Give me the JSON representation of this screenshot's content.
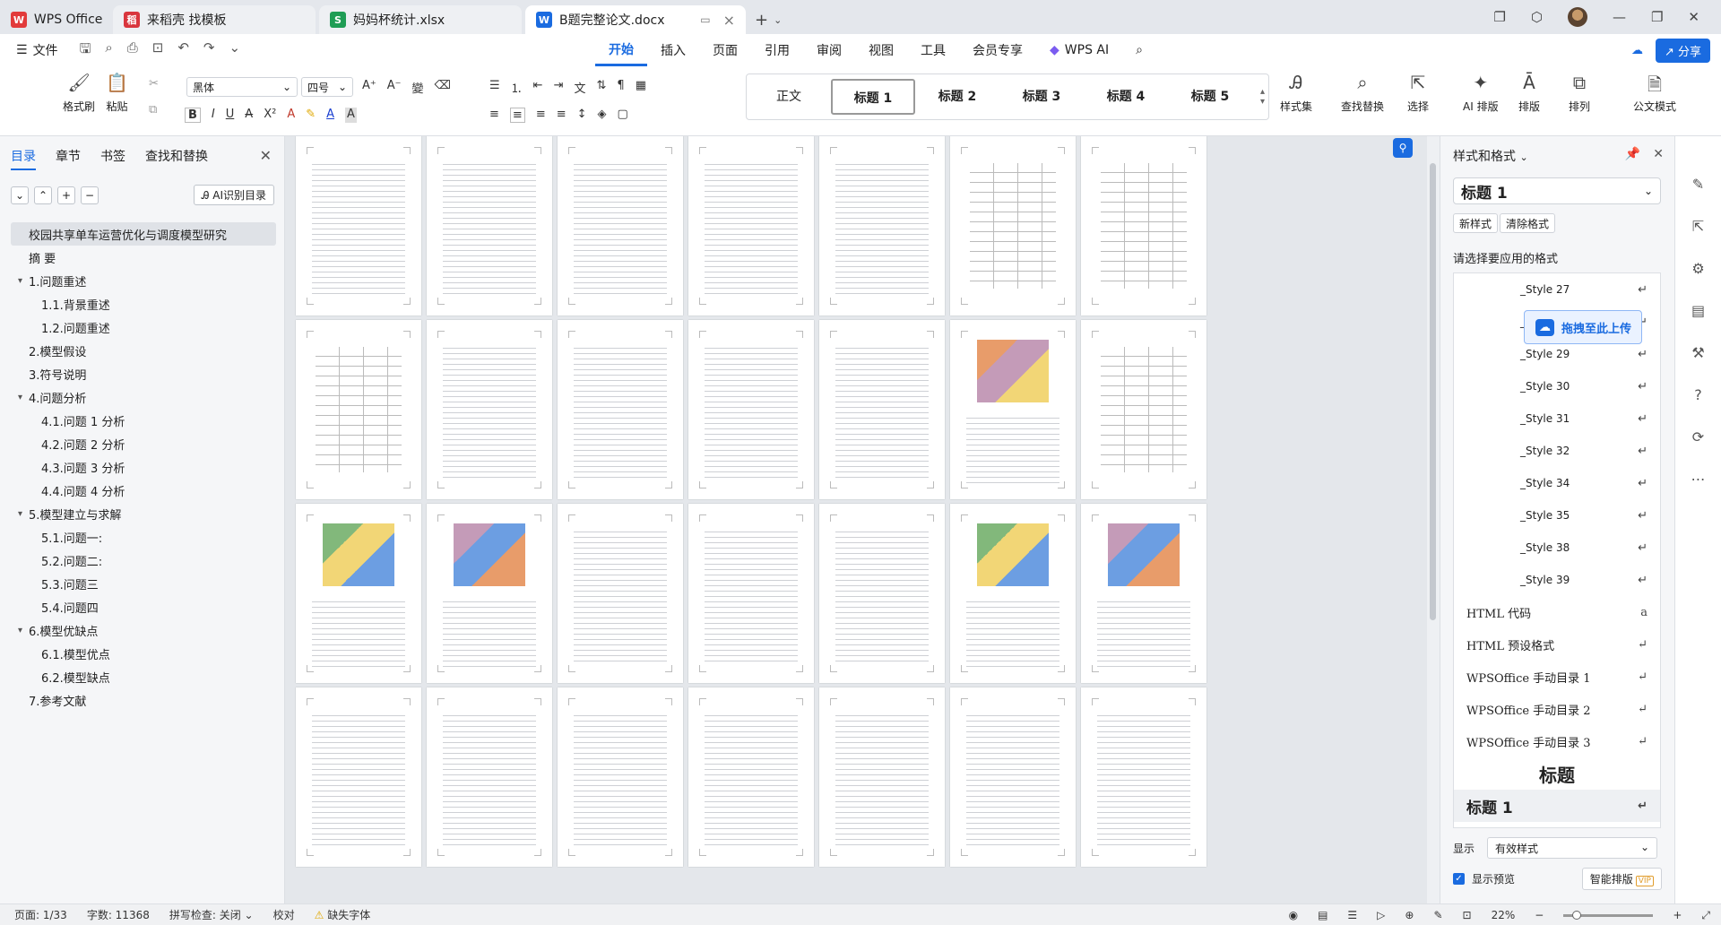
{
  "tabs": [
    {
      "label": "WPS Office",
      "badge": "W",
      "color": "#e23b3b"
    },
    {
      "label": "来稻壳 找模板",
      "badge": "稻",
      "color": "#d9363e"
    },
    {
      "label": "妈妈杯统计.xlsx",
      "badge": "S",
      "color": "#1f9d55"
    },
    {
      "label": "B题完整论文.docx",
      "badge": "W",
      "color": "#1a6be0"
    }
  ],
  "menu": {
    "file": "文件",
    "ribbon_tabs": [
      "开始",
      "插入",
      "页面",
      "引用",
      "审阅",
      "视图",
      "工具",
      "会员专享",
      "WPS AI"
    ],
    "share": "分享"
  },
  "ribbon": {
    "format_painter": "格式刷",
    "paste": "粘贴",
    "font_name": "黑体",
    "font_size": "四号",
    "styles": [
      "正文",
      "标题 1",
      "标题 2",
      "标题 3",
      "标题 4",
      "标题 5"
    ],
    "style_set": "样式集",
    "find_replace": "查找替换",
    "select": "选择",
    "ai_layout": "AI 排版",
    "layout": "排版",
    "arrange": "排列",
    "official": "公文模式"
  },
  "left_panel": {
    "tabs": [
      "目录",
      "章节",
      "书签",
      "查找和替换"
    ],
    "ai_toc": "AI识别目录",
    "toc": [
      {
        "text": "校园共享单车运营优化与调度模型研究",
        "level": 0,
        "selected": true
      },
      {
        "text": "摘  要",
        "level": 1
      },
      {
        "text": "1.问题重述",
        "level": 1,
        "expand": true
      },
      {
        "text": "1.1.背景重述",
        "level": 2
      },
      {
        "text": "1.2.问题重述",
        "level": 2
      },
      {
        "text": "2.模型假设",
        "level": 1
      },
      {
        "text": "3.符号说明",
        "level": 1
      },
      {
        "text": "4.问题分析",
        "level": 1,
        "expand": true
      },
      {
        "text": "4.1.问题 1 分析",
        "level": 2
      },
      {
        "text": "4.2.问题 2 分析",
        "level": 2
      },
      {
        "text": "4.3.问题 3 分析",
        "level": 2
      },
      {
        "text": "4.4.问题 4 分析",
        "level": 2
      },
      {
        "text": "5.模型建立与求解",
        "level": 1,
        "expand": true
      },
      {
        "text": "5.1.问题一:",
        "level": 2
      },
      {
        "text": "5.2.问题二:",
        "level": 2
      },
      {
        "text": "5.3.问题三",
        "level": 2
      },
      {
        "text": "5.4.问题四",
        "level": 2
      },
      {
        "text": "6.模型优缺点",
        "level": 1,
        "expand": true
      },
      {
        "text": "6.1.模型优点",
        "level": 2
      },
      {
        "text": "6.2.模型缺点",
        "level": 2
      },
      {
        "text": "7.参考文献",
        "level": 1
      }
    ]
  },
  "upload_chip": "拖拽至此上传",
  "right_panel": {
    "title": "样式和格式",
    "current_style": "标题 1",
    "new_style": "新样式",
    "clear_format": "清除格式",
    "apply_label": "请选择要应用的格式",
    "styles": [
      "_Style 27",
      "_Style 28",
      "_Style 29",
      "_Style 30",
      "_Style 31",
      "_Style 32",
      "_Style 34",
      "_Style 35",
      "_Style 38",
      "_Style 39",
      "HTML 代码",
      "HTML 预设格式",
      "WPSOffice 手动目录 1",
      "WPSOffice 手动目录 2",
      "WPSOffice 手动目录 3",
      "标题",
      "标题 1"
    ],
    "show_label": "显示",
    "show_value": "有效样式",
    "preview": "显示预览",
    "smart_layout": "智能排版",
    "vip": "VIP"
  },
  "status": {
    "page": "页面: 1/33",
    "words": "字数: 11368",
    "spell": "拼写检查: 关闭",
    "proof": "校对",
    "missing_font": "缺失字体",
    "zoom": "22%"
  }
}
